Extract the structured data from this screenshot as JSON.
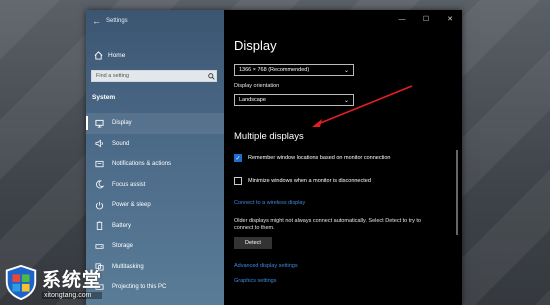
{
  "window": {
    "app_title": "Settings",
    "controls": {
      "minimize": "—",
      "maximize": "☐",
      "close": "✕"
    }
  },
  "sidebar": {
    "home_label": "Home",
    "search": {
      "placeholder": "Find a setting"
    },
    "section": "System",
    "items": [
      {
        "label": "Display",
        "icon": "monitor-icon",
        "active": true
      },
      {
        "label": "Sound",
        "icon": "speaker-icon"
      },
      {
        "label": "Notifications & actions",
        "icon": "notification-icon"
      },
      {
        "label": "Focus assist",
        "icon": "moon-icon"
      },
      {
        "label": "Power & sleep",
        "icon": "power-icon"
      },
      {
        "label": "Battery",
        "icon": "battery-icon"
      },
      {
        "label": "Storage",
        "icon": "storage-icon"
      },
      {
        "label": "Multitasking",
        "icon": "multitask-icon"
      },
      {
        "label": "Projecting to this PC",
        "icon": "project-icon"
      }
    ]
  },
  "content": {
    "title": "Display",
    "resolution": "1366 × 768 (Recommended)",
    "orientation_label": "Display orientation",
    "orientation": "Landscape",
    "multiple_displays_heading": "Multiple displays",
    "remember_windows": "Remember window locations based on monitor connection",
    "minimize_windows": "Minimize windows when a monitor is disconnected",
    "wireless_link": "Connect to a wireless display",
    "detect_help": "Older displays might not always connect automatically. Select Detect to try to connect to them.",
    "detect_button": "Detect",
    "advanced_link": "Advanced display settings",
    "graphics_link": "Graphics settings"
  },
  "watermark": {
    "title": "系统堂",
    "url": "xitongtang.com"
  },
  "colors": {
    "accent": "#1a6fd0",
    "link": "#3b8be0",
    "annotation": "#e02020",
    "sidebar": "#4b6a88"
  }
}
